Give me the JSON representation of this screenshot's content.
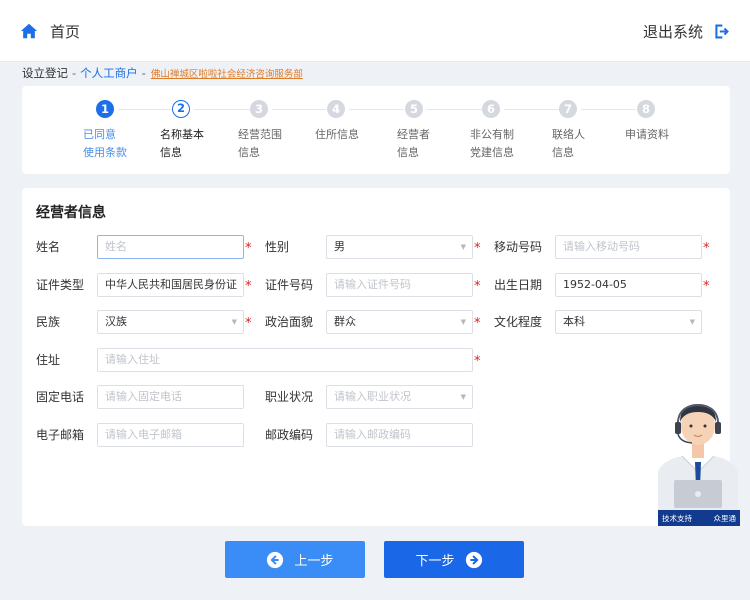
{
  "header": {
    "home_label": "首页",
    "logout_label": "退出系统",
    "accent": "#1d6fe8"
  },
  "breadcrumb": {
    "root": "设立登记",
    "sep": "-",
    "type": "个人工商户",
    "org": "佛山禅城区啦啦社会经济咨询服务部"
  },
  "steps": [
    {
      "num": "1",
      "line1": "已同意",
      "line2": "使用条款",
      "state": "done"
    },
    {
      "num": "2",
      "line1": "名称基本",
      "line2": "信息",
      "state": "active"
    },
    {
      "num": "3",
      "line1": "经营范围",
      "line2": "信息",
      "state": "todo"
    },
    {
      "num": "4",
      "line1": "住所信息",
      "line2": "",
      "state": "todo"
    },
    {
      "num": "5",
      "line1": "经营者",
      "line2": "信息",
      "state": "todo"
    },
    {
      "num": "6",
      "line1": "非公有制",
      "line2": "党建信息",
      "state": "todo"
    },
    {
      "num": "7",
      "line1": "联络人",
      "line2": "信息",
      "state": "todo"
    },
    {
      "num": "8",
      "line1": "申请资料",
      "line2": "",
      "state": "todo"
    }
  ],
  "form": {
    "title": "经营者信息",
    "name": {
      "label": "姓名",
      "value": "",
      "placeholder": "姓名"
    },
    "gender": {
      "label": "性别",
      "value": "男"
    },
    "mobile": {
      "label": "移动号码",
      "value": "",
      "placeholder": "请输入移动号码"
    },
    "id_type": {
      "label": "证件类型",
      "value": "中华人民共和国居民身份证"
    },
    "id_number": {
      "label": "证件号码",
      "value": "",
      "placeholder": "请输入证件号码"
    },
    "birth_date": {
      "label": "出生日期",
      "value": "1952-04-05"
    },
    "ethnicity": {
      "label": "民族",
      "value": "汉族"
    },
    "political_status": {
      "label": "政治面貌",
      "value": "群众"
    },
    "education": {
      "label": "文化程度",
      "value": "本科"
    },
    "address": {
      "label": "住址",
      "value": "",
      "placeholder": "请输入住址"
    },
    "landline": {
      "label": "固定电话",
      "value": "",
      "placeholder": "请输入固定电话"
    },
    "occupation": {
      "label": "职业状况",
      "value": "",
      "placeholder": "请输入职业状况"
    },
    "email": {
      "label": "电子邮箱",
      "value": "",
      "placeholder": "请输入电子邮箱"
    },
    "postcode": {
      "label": "邮政编码",
      "value": "",
      "placeholder": "请输入邮政编码"
    },
    "required_mark": "*"
  },
  "footer": {
    "prev_label": "上一步",
    "next_label": "下一步"
  },
  "support": {
    "label": "技术支持",
    "brand": "众里通"
  }
}
